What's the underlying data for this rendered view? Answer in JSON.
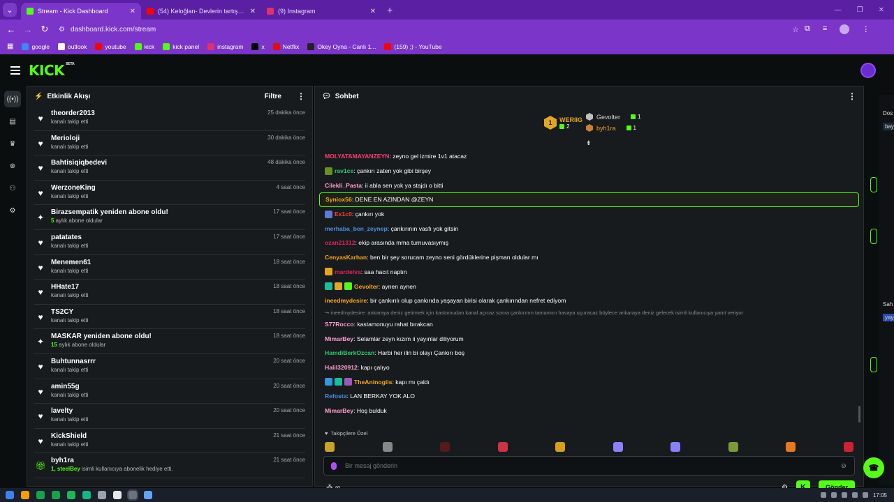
{
  "browser": {
    "tabs": [
      {
        "title": "Stream - Kick Dashboard",
        "active": true,
        "favicon_color": "#53fc18"
      },
      {
        "title": "(54) Keloğlan- Devlerin tartışma...",
        "active": false,
        "favicon_color": "#ff0000"
      },
      {
        "title": "(9) Instagram",
        "active": false,
        "favicon_color": "#e1306c"
      }
    ],
    "url": "dashboard.kick.com/stream",
    "bookmarks": [
      {
        "label": "google",
        "color": "#4285f4"
      },
      {
        "label": "outlook",
        "color": "#ffffff"
      },
      {
        "label": "youtube",
        "color": "#ff0000"
      },
      {
        "label": "kick",
        "color": "#53fc18"
      },
      {
        "label": "kick panel",
        "color": "#53fc18"
      },
      {
        "label": "instagram",
        "color": "#e1306c"
      },
      {
        "label": "x",
        "color": "#000000"
      },
      {
        "label": "Netflix",
        "color": "#e50914"
      },
      {
        "label": "Okey Oyna - Canlı 1...",
        "color": "#222222"
      },
      {
        "label": "(159) ;) - YouTube",
        "color": "#ff0000"
      }
    ]
  },
  "kick": {
    "logo": "KICK",
    "logo_tag": "BETA",
    "accent": "#53fc18"
  },
  "rail": [
    "broadcast-icon",
    "dashboard-icon",
    "trophy-icon",
    "community-icon",
    "users-icon",
    "settings-icon"
  ],
  "activity": {
    "title": "Etkinlik Akışı",
    "filter": "Filtre",
    "events": [
      {
        "name": "theorder2013",
        "sub": "kanalı takip etti",
        "time": "25 dakika önce",
        "type": "follow"
      },
      {
        "name": "Merioloji",
        "sub": "kanalı takip etti",
        "time": "30 dakika önce",
        "type": "follow"
      },
      {
        "name": "Bahtisiqiqbedevi",
        "sub": "kanalı takip etti",
        "time": "48 dakika önce",
        "type": "follow"
      },
      {
        "name": "WerzoneKing",
        "sub": "kanalı takip etti",
        "time": "4 saat önce",
        "type": "follow"
      },
      {
        "name": "Birazsempatik yeniden abone oldu!",
        "sub_hl": "5",
        "sub": " aylık abone oldular",
        "time": "17 saat önce",
        "type": "sub"
      },
      {
        "name": "patatates",
        "sub": "kanalı takip etti",
        "time": "17 saat önce",
        "type": "follow"
      },
      {
        "name": "Menemen61",
        "sub": "kanalı takip etti",
        "time": "18 saat önce",
        "type": "follow"
      },
      {
        "name": "HHate17",
        "sub": "kanalı takip etti",
        "time": "18 saat önce",
        "type": "follow"
      },
      {
        "name": "TS2CY",
        "sub": "kanalı takip etti",
        "time": "18 saat önce",
        "type": "follow"
      },
      {
        "name": "MASKAR yeniden abone oldu!",
        "sub_hl": "15",
        "sub": " aylık abone oldular",
        "time": "18 saat önce",
        "type": "sub"
      },
      {
        "name": "Buhtunnasrrr",
        "sub": "kanalı takip etti",
        "time": "20 saat önce",
        "type": "follow"
      },
      {
        "name": "amin55g",
        "sub": "kanalı takip etti",
        "time": "20 saat önce",
        "type": "follow"
      },
      {
        "name": "lavelty",
        "sub": "kanalı takip etti",
        "time": "20 saat önce",
        "type": "follow"
      },
      {
        "name": "KickShield",
        "sub": "kanalı takip etti",
        "time": "21 saat önce",
        "type": "follow"
      },
      {
        "name": "byh1ra",
        "sub_hl": "1, steelBey",
        "sub": " isimli kullanıcıya abonelik hediye etti.",
        "time": "21 saat önce",
        "type": "gift"
      }
    ]
  },
  "chat": {
    "title": "Sohbet",
    "leaderboard": {
      "first": {
        "rank": "1",
        "name": "WERIIG",
        "count": "2"
      },
      "others": [
        {
          "name": "Gevolter",
          "count": "1",
          "name_color": "#cfcfcf",
          "hex_color": "#c0c0c0"
        },
        {
          "name": "byh1ra",
          "count": "1",
          "name_color": "#e1a724",
          "hex_color": "#cd7f32"
        }
      ]
    },
    "messages": [
      {
        "user": "MOLYATAMAYANZEYN",
        "color": "#ff3d6e",
        "text": ": zeyno gel izmire 1v1 atacaz",
        "badges": []
      },
      {
        "user": "rav1ce",
        "color": "#2ecc71",
        "text": ": çankırı zaten yok gibi birşey",
        "badges": [
          "#6b8e23"
        ]
      },
      {
        "user": "Cilekli_Pasta",
        "color": "#ff9ecf",
        "text": ": ii abla sen yok ya stajdı o bitti",
        "badges": []
      },
      {
        "user": "Syniox56",
        "color": "#f5a623",
        "text": ": DENE EN AZINDAN @ZEYN",
        "badges": [],
        "highlight": true
      },
      {
        "user": "Ex1c0",
        "color": "#ff3d3d",
        "text": ": çankırı yok",
        "badges": [
          "#5a7bd8"
        ]
      },
      {
        "user": "merhaba_ben_zeynep",
        "color": "#4a90e2",
        "text": ": çankırının vasfı yok gitsin",
        "badges": []
      },
      {
        "user": "ozan21312",
        "color": "#e0245e",
        "text": ": ekip arasında mma turnuvasıymış",
        "badges": []
      },
      {
        "user": "CenyasKarhan",
        "color": "#f5a623",
        "text": ": ben bir şey sorucam zeyno seni gördüklerine pişman oldular mı",
        "badges": []
      },
      {
        "user": "mardelva",
        "color": "#e0245e",
        "text": ": saa hacıt naptın",
        "badges": [
          "#e1a724"
        ]
      },
      {
        "user": "Gevolter",
        "color": "#f5a623",
        "text": ": aynen aynen",
        "badges": [
          "#1abc9c",
          "#e1a724",
          "#53fc18"
        ]
      },
      {
        "user": "ineedmydesire",
        "color": "#f5a623",
        "text": ": bir çankırılı olup çankırıda yaşayan birisi olarak çankırından nefret ediyom",
        "badges": []
      },
      {
        "user": "",
        "color": "#8a8a8a",
        "text": "↪ ineedmydesire: ankaraya deniz getirmek için kastomudan kanal açıcaz sonra çankırının tamamını havaya uçuracaz böylece ankaraya deniz gelecek isimli kullanıcıya yanıt veriyor",
        "badges": [],
        "reply": true
      },
      {
        "user": "S77Rocco",
        "color": "#ff9ecf",
        "text": ": kastamonuyu rahat bırakcan",
        "badges": []
      },
      {
        "user": "MimarBey",
        "color": "#ff9ecf",
        "text": ": Selamlar zeyn kızım ii yayınlar diliyorum",
        "badges": []
      },
      {
        "user": "HamdiBerkOzcan",
        "color": "#2ecc71",
        "text": ": Harbi her ilin bi olayı Çankırı boş",
        "badges": []
      },
      {
        "user": "Halil320912",
        "color": "#ff9ecf",
        "text": ": kapı çalıyo",
        "badges": []
      },
      {
        "user": "TheAninogiis",
        "color": "#f5a623",
        "text": ": kapı mı çaldı",
        "badges": [
          "#3498db",
          "#1abc9c",
          "#9b59b6"
        ]
      },
      {
        "user": "Refosta",
        "color": "#4a90e2",
        "text": ": LAN BERKAY YOK ALO",
        "badges": []
      },
      {
        "user": "MimarBey",
        "color": "#ff9ecf",
        "text": ": Hoş bulduk",
        "badges": []
      }
    ],
    "followers_only": "Takipçilere Özel",
    "emote_colors": [
      "#c9a227",
      "#888888",
      "#551a1a",
      "#cc3344",
      "#d4a017",
      "#8a7fff",
      "#8a7fff",
      "#7a9a3a",
      "#e87722",
      "#cc2233"
    ],
    "input_placeholder": "Bir mesaj gönderin",
    "send_label": "Gönder"
  },
  "sliver": {
    "texts": [
      "Dos",
      "bay",
      "Sah",
      "yay"
    ]
  },
  "taskbar": {
    "time": "17:05",
    "icons": [
      "#3b82f6",
      "#f59e0b",
      "#16a34a",
      "#16a34a",
      "#1db954",
      "#10b981",
      "#9ca3af",
      "#e5e7eb",
      "#6b7280",
      "#60a5fa"
    ]
  }
}
